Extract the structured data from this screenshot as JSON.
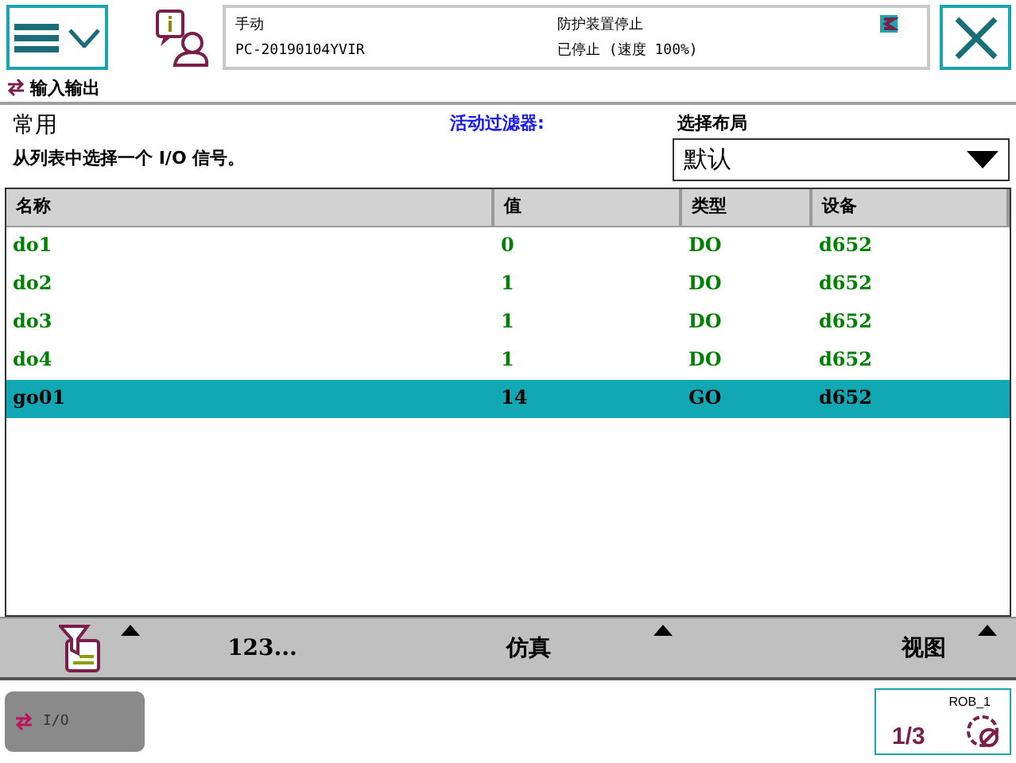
{
  "header": {
    "mode": "手动",
    "controller": "PC-20190104YVIR",
    "safety": "防护装置停止",
    "status": "已停止 (速度 100%)"
  },
  "breadcrumb": "输入输出",
  "section": {
    "title": "常用",
    "description": "从列表中选择一个 I/O 信号。",
    "filter_label": "活动过滤器:",
    "layout_label": "选择布局",
    "layout_value": "默认"
  },
  "table": {
    "columns": [
      "名称",
      "值",
      "类型",
      "设备"
    ],
    "rows": [
      {
        "cells": [
          "do1",
          "0",
          "DO",
          "d652"
        ],
        "selected": false
      },
      {
        "cells": [
          "do2",
          "1",
          "DO",
          "d652"
        ],
        "selected": false
      },
      {
        "cells": [
          "do3",
          "1",
          "DO",
          "d652"
        ],
        "selected": false
      },
      {
        "cells": [
          "do4",
          "1",
          "DO",
          "d652"
        ],
        "selected": false
      },
      {
        "cells": [
          "go01",
          "14",
          "GO",
          "d652"
        ],
        "selected": true
      }
    ]
  },
  "toolbar": [
    {
      "kind": "icon",
      "menu": true
    },
    {
      "kind": "text",
      "label": "123..."
    },
    {
      "kind": "text",
      "label": "仿真",
      "menu": true
    },
    {
      "kind": "text",
      "label": "视图",
      "menu": true
    }
  ],
  "taskbar": {
    "app_label": "I/O",
    "robot": "ROB_1",
    "fraction": "1/3"
  }
}
